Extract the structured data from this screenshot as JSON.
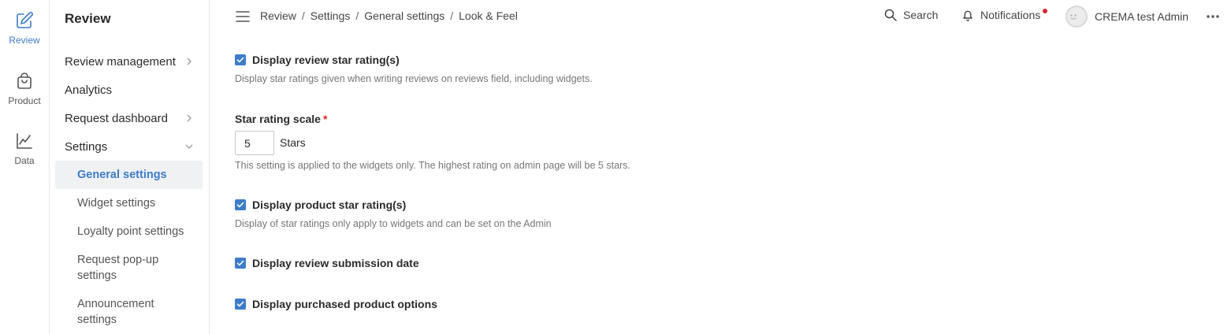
{
  "rail": {
    "items": [
      {
        "label": "Review",
        "icon": "edit-icon",
        "active": true
      },
      {
        "label": "Product",
        "icon": "shopping-bag-icon",
        "active": false
      },
      {
        "label": "Data",
        "icon": "line-chart-icon",
        "active": false
      }
    ]
  },
  "nav": {
    "title": "Review",
    "items": [
      {
        "label": "Review management",
        "chevron": "right"
      },
      {
        "label": "Analytics"
      },
      {
        "label": "Request dashboard",
        "chevron": "right"
      },
      {
        "label": "Settings",
        "chevron": "down"
      }
    ],
    "sub_items": [
      {
        "label": "General settings",
        "active": true
      },
      {
        "label": "Widget settings"
      },
      {
        "label": "Loyalty point settings"
      },
      {
        "label": "Request pop-up settings"
      },
      {
        "label": "Announcement settings"
      }
    ]
  },
  "topbar": {
    "breadcrumb": [
      "Review",
      "Settings",
      "General settings",
      "Look & Feel"
    ],
    "search_label": "Search",
    "notifications_label": "Notifications",
    "user_name": "CREMA test Admin"
  },
  "settings": {
    "display_review_star": {
      "label": "Display review star rating(s)",
      "checked": true,
      "help": "Display star ratings given when writing reviews on reviews field, including widgets."
    },
    "star_scale": {
      "label": "Star rating scale",
      "required_mark": "*",
      "value": "5",
      "unit": "Stars",
      "help": "This setting is applied to the widgets only. The highest rating on admin page will be 5 stars."
    },
    "display_product_star": {
      "label": "Display product star rating(s)",
      "checked": true,
      "help": "Display of star ratings only apply to widgets and can be set on the Admin"
    },
    "display_submission_date": {
      "label": "Display review submission date",
      "checked": true
    },
    "display_purchased_options": {
      "label": "Display purchased product options",
      "checked": true
    }
  },
  "colors": {
    "accent": "#3d7cc9",
    "notification_dot": "#d9252a",
    "required": "#d9252a"
  }
}
